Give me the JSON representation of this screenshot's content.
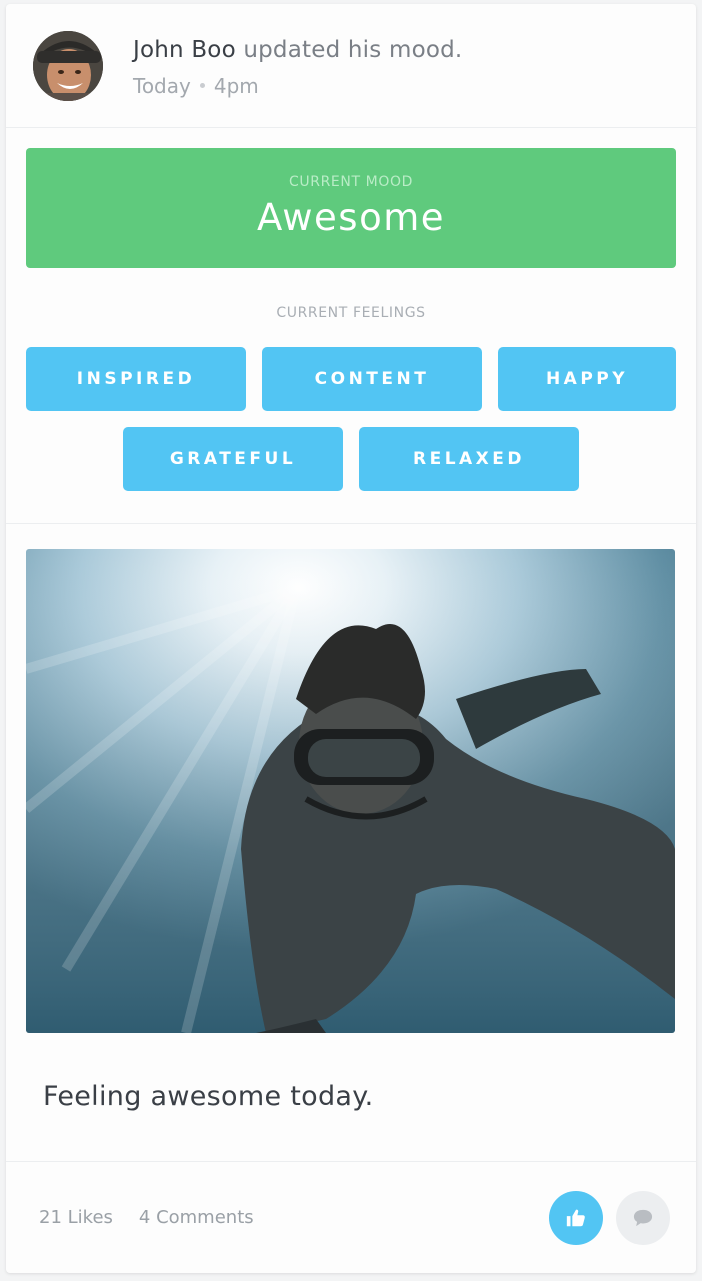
{
  "post": {
    "author": "John Boo",
    "action": "updated his mood.",
    "day": "Today",
    "time": "4pm"
  },
  "mood": {
    "label": "CURRENT MOOD",
    "value": "Awesome",
    "color": "#5fca7d"
  },
  "feelings": {
    "label": "CURRENT FEELINGS",
    "items": [
      "INSPIRED",
      "CONTENT",
      "HAPPY",
      "GRATEFUL",
      "RELAXED"
    ],
    "color": "#52c5f3"
  },
  "caption": "Feeling awesome today.",
  "stats": {
    "likes": "21 Likes",
    "comments": "4 Comments"
  },
  "actions": {
    "like_icon": "thumbs-up-icon",
    "comment_icon": "comment-bubble-icon"
  }
}
